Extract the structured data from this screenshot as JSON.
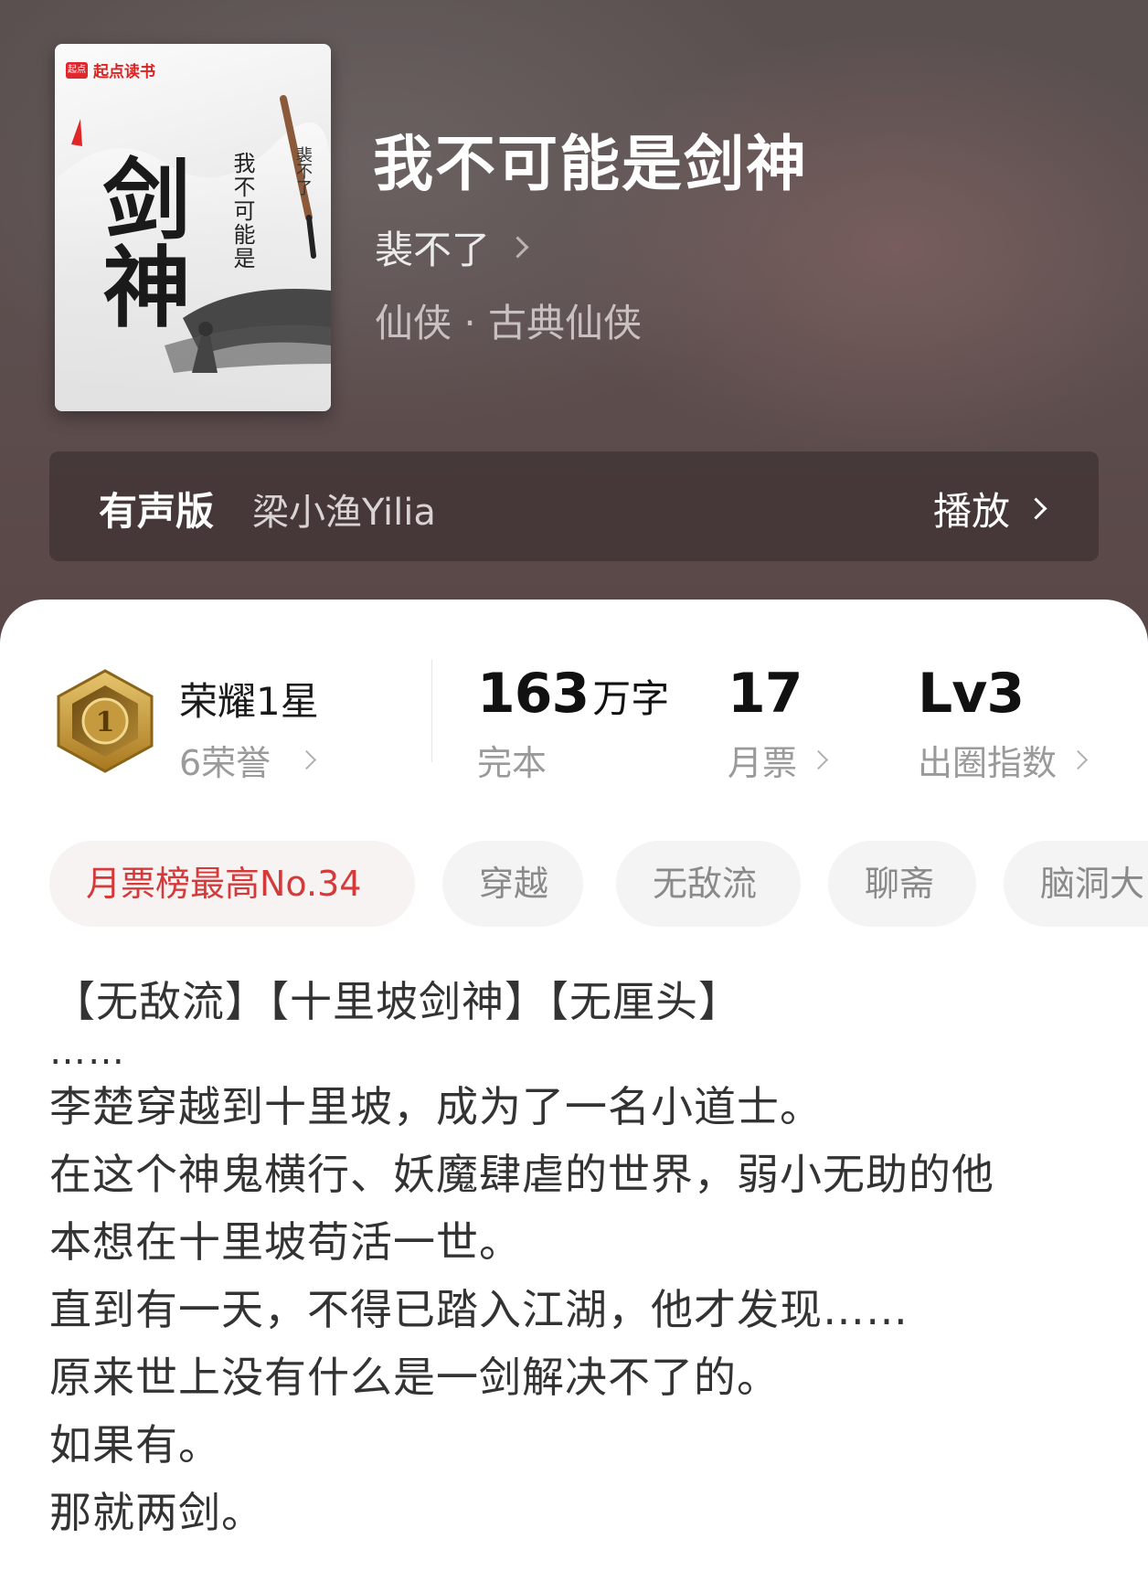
{
  "book": {
    "title": "我不可能是剑神",
    "author": "裴不了",
    "genre": "仙侠 · 古典仙侠",
    "cover": {
      "brand": "起点读书",
      "brand_logo": "起点",
      "big_text": "剑神",
      "sub_text": "我不可能是",
      "author_text": "裴不了"
    }
  },
  "audio": {
    "label": "有声版",
    "narrator": "梁小渔Yilia",
    "play_label": "播放"
  },
  "stats": {
    "honor_title": "荣耀1星",
    "honor_sub": "6荣誉",
    "badge_number": "1",
    "words_value": "163",
    "words_unit": "万字",
    "words_label": "完本",
    "tickets_value": "17",
    "tickets_label": "月票",
    "index_value": "Lv3",
    "index_label": "出圈指数"
  },
  "tags": [
    "月票榜最高No.34",
    "穿越",
    "无敌流",
    "聊斋",
    "脑洞大"
  ],
  "synopsis": {
    "tag_line": "【无敌流】【十里坡剑神】【无厘头】",
    "dots": "……",
    "lines": [
      "李楚穿越到十里坡，成为了一名小道士。",
      "在这个神鬼横行、妖魔肆虐的世界，弱小无助的他",
      "本想在十里坡苟活一世。",
      "直到有一天，不得已踏入江湖，他才发现……",
      "原来世上没有什么是一剑解决不了的。",
      "如果有。",
      "那就两剑。"
    ]
  },
  "colors": {
    "hero_bg": "#5a4a4a",
    "highlight_tag": "#d53a3a",
    "badge_gold": "#c9a24a"
  },
  "icons": [
    "chevron-right-icon",
    "honor-badge-icon",
    "brand-logo-icon"
  ]
}
